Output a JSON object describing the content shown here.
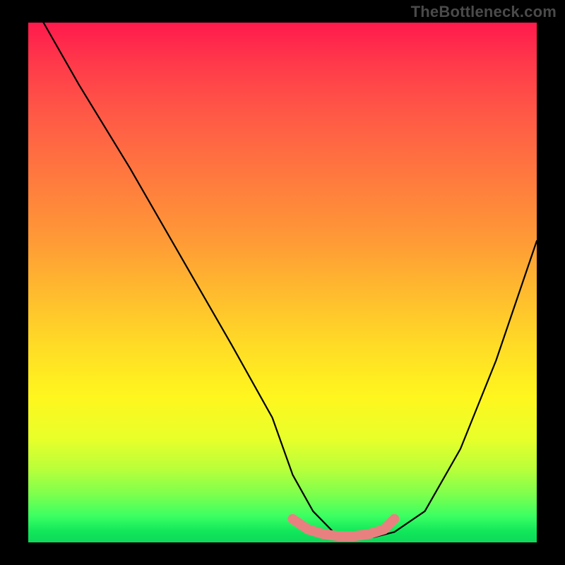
{
  "watermark": "TheBottleneck.com",
  "chart_data": {
    "type": "line",
    "title": "",
    "xlabel": "",
    "ylabel": "",
    "xlim": [
      0,
      100
    ],
    "ylim": [
      0,
      100
    ],
    "series": [
      {
        "name": "black-curve",
        "color": "#000000",
        "x": [
          3,
          10,
          20,
          30,
          40,
          48,
          52,
          56,
          60,
          64,
          68,
          72,
          78,
          85,
          92,
          100
        ],
        "values": [
          100,
          88,
          72,
          55,
          38,
          24,
          13,
          6,
          2,
          1,
          1,
          2,
          6,
          18,
          35,
          58
        ]
      },
      {
        "name": "pink-valley",
        "color": "#e98080",
        "x": [
          52,
          55,
          58,
          61,
          64,
          67,
          70,
          72
        ],
        "values": [
          4.5,
          2.5,
          1.6,
          1.2,
          1.2,
          1.6,
          2.5,
          4.5
        ]
      }
    ],
    "gradient_stops": [
      {
        "pos": 0,
        "color": "#ff1a4d"
      },
      {
        "pos": 50,
        "color": "#ffbb2e"
      },
      {
        "pos": 75,
        "color": "#fff61e"
      },
      {
        "pos": 100,
        "color": "#0ed95a"
      }
    ]
  }
}
